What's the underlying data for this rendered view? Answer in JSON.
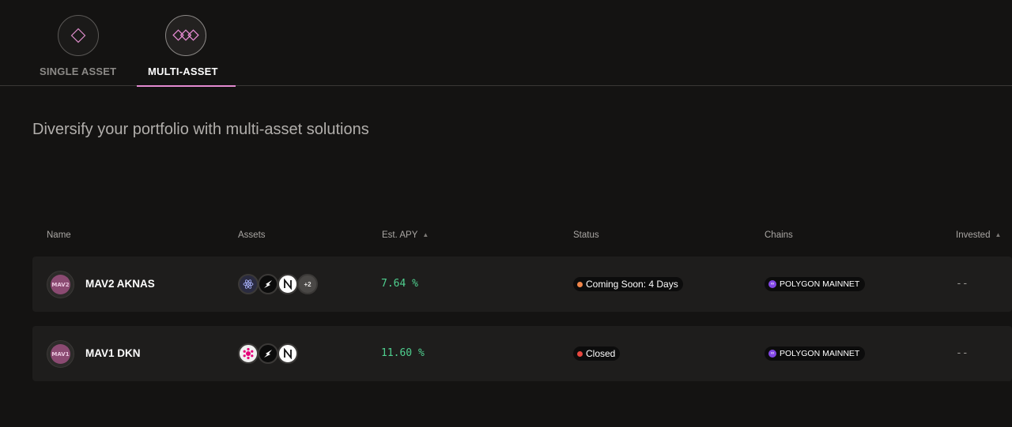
{
  "tabs": [
    {
      "label": "SINGLE ASSET",
      "icon": "diamond-icon",
      "active": false
    },
    {
      "label": "MULTI-ASSET",
      "icon": "multi-diamond-icon",
      "active": true
    }
  ],
  "headline": "Diversify your portfolio with multi-asset solutions",
  "table": {
    "columns": [
      "Name",
      "Assets",
      "Est. APY",
      "Status",
      "Chains",
      "Invested"
    ],
    "rows": [
      {
        "logo_text": "MAV2",
        "name": "MAV2 AKNAS",
        "assets": [
          "atom-icon",
          "dash-icon",
          "near-icon"
        ],
        "more_assets": "+2",
        "apy": "7.64 %",
        "status": "Coming Soon: 4 Days",
        "status_color": "#f0864a",
        "chain": "POLYGON MAINNET",
        "invested": "--"
      },
      {
        "logo_text": "MAV1",
        "name": "MAV1 DKN",
        "assets": [
          "polkadot-icon",
          "dash-icon",
          "near-icon"
        ],
        "apy": "11.60 %",
        "status": "Closed",
        "status_color": "#e8473f",
        "chain": "POLYGON MAINNET",
        "invested": "--"
      }
    ]
  },
  "colors": {
    "accent": "#e38ad0",
    "apy_green": "#4fd08f",
    "polygon_purple": "#8247e5"
  }
}
